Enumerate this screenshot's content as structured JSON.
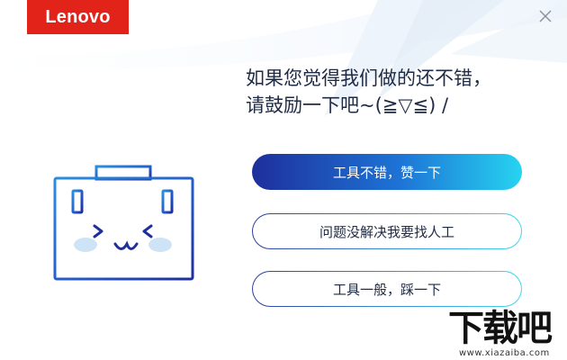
{
  "brand": {
    "logo_text": "Lenovo",
    "color": "#e2231a"
  },
  "window": {
    "close_icon": "close-icon"
  },
  "message": {
    "line1": "如果您觉得我们做的还不错，",
    "line2": "请鼓励一下吧~(≧▽≦) /"
  },
  "buttons": {
    "good": "工具不错，赞一下",
    "issue": "问题没解决我要找人工",
    "average": "工具一般，踩一下"
  },
  "illustration": {
    "icon": "smiling-toolbox-icon"
  },
  "watermark": {
    "main": "下载吧",
    "sub": "www.xiazaiba.com"
  },
  "colors": {
    "accent_dark": "#1e2f9b",
    "accent_light": "#27d3f0",
    "text": "#1f2a44"
  }
}
